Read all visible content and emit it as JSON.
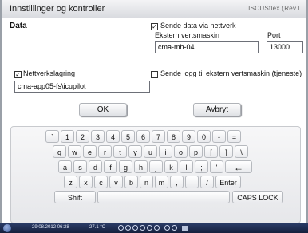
{
  "window": {
    "title": "Innstillinger og kontroller",
    "brand": "ISCUSflex (Rev.L"
  },
  "data_section": {
    "heading": "Data"
  },
  "send_network": {
    "checked": true,
    "label": "Sende data via nettverk"
  },
  "external_host": {
    "label": "Ekstern vertsmaskin",
    "value": "cma-mh-04"
  },
  "port": {
    "label": "Port",
    "value": "13000"
  },
  "network_storage": {
    "checked": true,
    "label": "Nettverkslagring",
    "value": "cma-app05-fs\\icupilot"
  },
  "send_log": {
    "checked": false,
    "label": "Sende logg til ekstern vertsmaskin (tjeneste)"
  },
  "buttons": {
    "ok": "OK",
    "cancel": "Avbryt"
  },
  "keyboard": {
    "row1": [
      "`",
      "1",
      "2",
      "3",
      "4",
      "5",
      "6",
      "7",
      "8",
      "9",
      "0",
      "-",
      "="
    ],
    "row2": [
      "q",
      "w",
      "e",
      "r",
      "t",
      "y",
      "u",
      "i",
      "o",
      "p",
      "[",
      "]",
      "\\"
    ],
    "row3": [
      "a",
      "s",
      "d",
      "f",
      "g",
      "h",
      "j",
      "k",
      "l",
      ";",
      "'",
      "←"
    ],
    "row4": [
      "z",
      "x",
      "c",
      "v",
      "b",
      "n",
      "m",
      ",",
      ".",
      "/",
      "Enter"
    ],
    "row5": {
      "shift": "Shift",
      "space": "",
      "caps": "CAPS LOCK"
    }
  },
  "taskbar": {
    "datetime": "29.08.2012 06:28",
    "temp": "27.1 °C"
  },
  "icons": {
    "check": "checkmark-icon",
    "start": "start-orb-icon",
    "backspace": "backspace-arrow-icon"
  }
}
